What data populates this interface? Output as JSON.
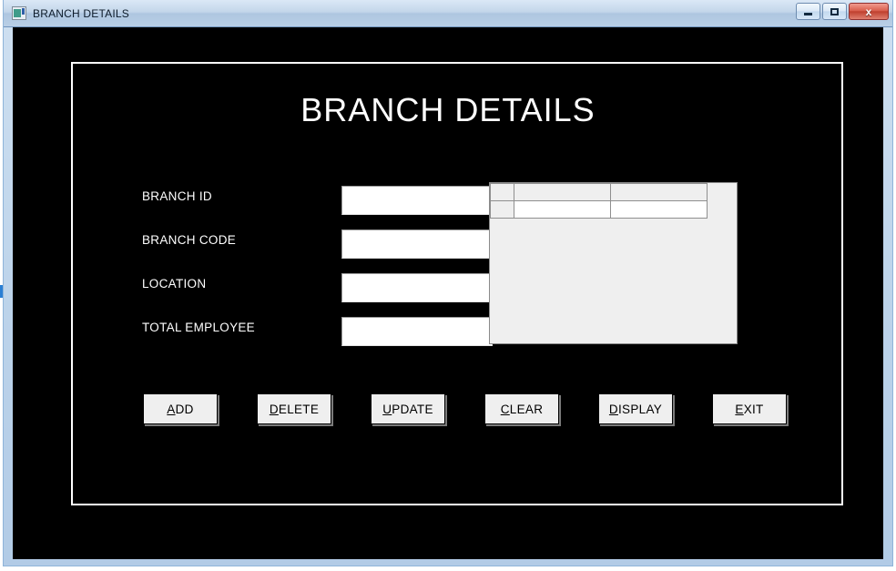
{
  "window": {
    "title": "BRANCH DETAILS",
    "icon": "form-window-icon",
    "controls": {
      "minimize": "minimize-icon",
      "maximize": "maximize-icon",
      "close_label": "x"
    },
    "colors": {
      "client_background": "#000000",
      "titlebar_accent": "#b2cbe6",
      "close_button": "#c0402f",
      "frame_border": "#ffffff",
      "control_face": "#efefef"
    }
  },
  "form": {
    "heading": "BRANCH DETAILS",
    "fields": [
      {
        "label": "BRANCH ID",
        "value": "",
        "placeholder": "",
        "name": "branch-id"
      },
      {
        "label": "BRANCH CODE",
        "value": "",
        "placeholder": "",
        "name": "branch-code"
      },
      {
        "label": "LOCATION",
        "value": "",
        "placeholder": "",
        "name": "location"
      },
      {
        "label": "TOTAL EMPLOYEE",
        "value": "",
        "placeholder": "",
        "name": "total-employee"
      }
    ],
    "grid": {
      "row_header": "",
      "columns": [
        "",
        ""
      ],
      "rows": [
        {
          "header": "",
          "cells": [
            "",
            ""
          ]
        }
      ]
    },
    "buttons": [
      {
        "mnemonic": "A",
        "rest": "DD"
      },
      {
        "mnemonic": "D",
        "rest": "ELETE"
      },
      {
        "mnemonic": "U",
        "rest": "PDATE"
      },
      {
        "mnemonic": "C",
        "rest": "LEAR"
      },
      {
        "mnemonic": "D",
        "rest": "ISPLAY"
      },
      {
        "mnemonic": "E",
        "rest": "XIT"
      }
    ]
  }
}
